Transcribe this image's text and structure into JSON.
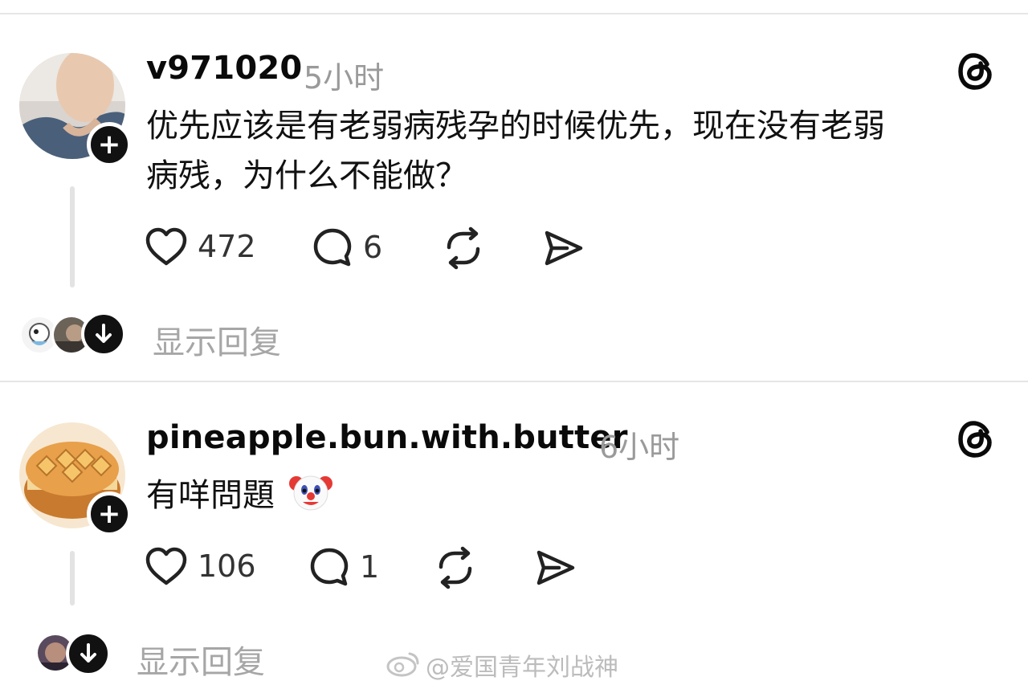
{
  "posts": [
    {
      "username": "v971020",
      "time": "5小时",
      "text_lines": [
        "优先应该是有老弱病残孕的时候优先，现在没有老弱",
        "病残，为什么不能做？"
      ],
      "likes": "472",
      "comments": "6",
      "show_replies": "显示回复"
    },
    {
      "username": "pineapple.bun.with.butter",
      "time": "6小时",
      "text_lines": [
        "有咩問題"
      ],
      "emoji": "clown-face",
      "likes": "106",
      "comments": "1",
      "show_replies": "显示回复"
    }
  ],
  "icons": {
    "like": "heart-icon",
    "comment": "comment-bubble-icon",
    "repost": "repost-icon",
    "share": "send-icon",
    "app": "threads-logo-icon",
    "follow": "plus-icon",
    "expand": "arrow-down-icon"
  },
  "watermark": {
    "text": "@爱国青年刘战神"
  },
  "colors": {
    "text": "#101010",
    "muted": "#9a9a9a",
    "divider": "#e6e6e6",
    "follow_button": "#111111"
  }
}
